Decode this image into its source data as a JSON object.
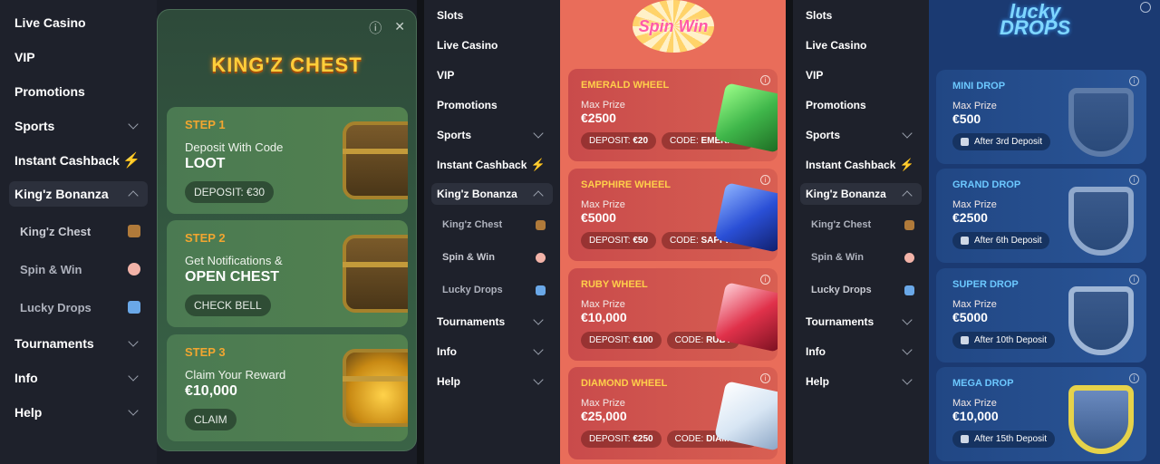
{
  "sidebar1": {
    "items": [
      {
        "label": "Live Casino"
      },
      {
        "label": "VIP"
      },
      {
        "label": "Promotions"
      },
      {
        "label": "Sports"
      },
      {
        "label": "Instant Cashback"
      },
      {
        "label": "King'z Bonanza"
      },
      {
        "label": "King'z Chest"
      },
      {
        "label": "Spin & Win"
      },
      {
        "label": "Lucky Drops"
      },
      {
        "label": "Tournaments"
      },
      {
        "label": "Info"
      },
      {
        "label": "Help"
      }
    ]
  },
  "kings_chest": {
    "logo": "KING'Z CHEST",
    "steps": [
      {
        "num": "STEP 1",
        "line1": "Deposit With Code",
        "line2": "LOOT",
        "pill": "DEPOSIT: €30"
      },
      {
        "num": "STEP 2",
        "line1": "Get Notifications &",
        "line2": "OPEN CHEST",
        "pill": "CHECK BELL"
      },
      {
        "num": "STEP 3",
        "line1": "Claim Your Reward",
        "line2": "€10,000",
        "pill": "CLAIM"
      }
    ]
  },
  "sidebar2": {
    "items": [
      {
        "label": "Slots"
      },
      {
        "label": "Live Casino"
      },
      {
        "label": "VIP"
      },
      {
        "label": "Promotions"
      },
      {
        "label": "Sports"
      },
      {
        "label": "Instant Cashback"
      },
      {
        "label": "King'z Bonanza"
      },
      {
        "label": "King'z Chest"
      },
      {
        "label": "Spin & Win"
      },
      {
        "label": "Lucky Drops"
      },
      {
        "label": "Tournaments"
      },
      {
        "label": "Info"
      },
      {
        "label": "Help"
      }
    ]
  },
  "spin_win": {
    "logo": "Spin Win",
    "wheels": [
      {
        "title": "EMERALD WHEEL",
        "max_label": "Max Prize",
        "prize": "€2500",
        "deposit_label": "DEPOSIT:",
        "deposit": "€20",
        "code_label": "CODE:",
        "code": "EMERALD",
        "gem": "#3fb64a"
      },
      {
        "title": "SAPPHIRE WHEEL",
        "max_label": "Max Prize",
        "prize": "€5000",
        "deposit_label": "DEPOSIT:",
        "deposit": "€50",
        "code_label": "CODE:",
        "code": "SAPPHIRE",
        "gem": "#2a4fd6"
      },
      {
        "title": "RUBY WHEEL",
        "max_label": "Max Prize",
        "prize": "€10,000",
        "deposit_label": "DEPOSIT:",
        "deposit": "€100",
        "code_label": "CODE:",
        "code": "RUBY",
        "gem": "#e0314a"
      },
      {
        "title": "DIAMOND WHEEL",
        "max_label": "Max Prize",
        "prize": "€25,000",
        "deposit_label": "DEPOSIT:",
        "deposit": "€250",
        "code_label": "CODE:",
        "code": "DIAMOND",
        "gem": "#d8e6f4"
      }
    ]
  },
  "sidebar3": {
    "items": [
      {
        "label": "Slots"
      },
      {
        "label": "Live Casino"
      },
      {
        "label": "VIP"
      },
      {
        "label": "Promotions"
      },
      {
        "label": "Sports"
      },
      {
        "label": "Instant Cashback"
      },
      {
        "label": "King'z Bonanza"
      },
      {
        "label": "King'z Chest"
      },
      {
        "label": "Spin & Win"
      },
      {
        "label": "Lucky Drops"
      },
      {
        "label": "Tournaments"
      },
      {
        "label": "Info"
      },
      {
        "label": "Help"
      }
    ]
  },
  "lucky_drops": {
    "logo_line1": "lucky",
    "logo_line2": "DROPS",
    "drops": [
      {
        "title": "MINI DROP",
        "max_label": "Max Prize",
        "prize": "€500",
        "unlock": "After 3rd Deposit"
      },
      {
        "title": "GRAND DROP",
        "max_label": "Max Prize",
        "prize": "€2500",
        "unlock": "After 6th Deposit"
      },
      {
        "title": "SUPER DROP",
        "max_label": "Max Prize",
        "prize": "€5000",
        "unlock": "After 10th Deposit"
      },
      {
        "title": "MEGA DROP",
        "max_label": "Max Prize",
        "prize": "€10,000",
        "unlock": "After 15th Deposit"
      }
    ]
  }
}
